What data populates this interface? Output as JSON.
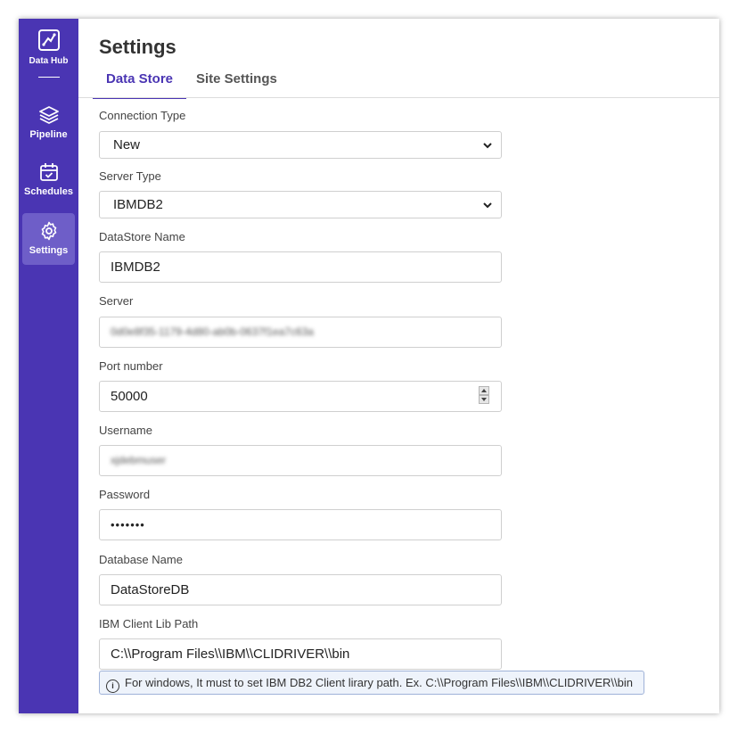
{
  "sidebar": {
    "brand": {
      "label": "Data Hub",
      "icon": "data-hub-logo-icon"
    },
    "items": [
      {
        "label": "Pipeline",
        "icon": "layers-icon",
        "active": false
      },
      {
        "label": "Schedules",
        "icon": "calendar-check-icon",
        "active": false
      },
      {
        "label": "Settings",
        "icon": "gear-icon",
        "active": true
      }
    ]
  },
  "page": {
    "title": "Settings"
  },
  "tabs": [
    {
      "label": "Data Store",
      "active": true
    },
    {
      "label": "Site Settings",
      "active": false
    }
  ],
  "form": {
    "connection_type": {
      "label": "Connection Type",
      "value": "New"
    },
    "server_type": {
      "label": "Server Type",
      "value": "IBMDB2"
    },
    "datastore_name": {
      "label": "DataStore Name",
      "value": "IBMDB2"
    },
    "server": {
      "label": "Server",
      "value": "0d0e8f35-1179-4d80-ab0b-0637f1ea7c63a"
    },
    "port": {
      "label": "Port number",
      "value": "50000"
    },
    "username": {
      "label": "Username",
      "value": "xjdebmuser"
    },
    "password": {
      "label": "Password",
      "value": "•••••••"
    },
    "database_name": {
      "label": "Database Name",
      "value": "DataStoreDB"
    },
    "ibm_client_lib_path": {
      "label": "IBM Client Lib Path",
      "value": "C:\\\\Program Files\\\\IBM\\\\CLIDRIVER\\\\bin"
    },
    "info_text": "For windows, It must to set IBM DB2 Client lirary path. Ex. C:\\\\Program Files\\\\IBM\\\\CLIDRIVER\\\\bin"
  },
  "colors": {
    "sidebar": "#4a35b3",
    "sidebar_active": "#6e5ec8",
    "accent": "#4a35b3",
    "info_bg": "#eef3fb",
    "info_border": "#9fb2d8"
  }
}
